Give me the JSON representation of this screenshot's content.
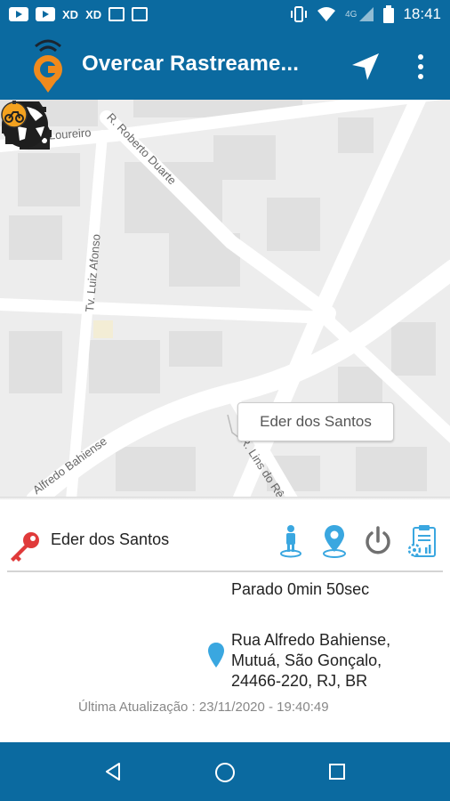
{
  "status_bar": {
    "clock": "18:41",
    "network": "4G",
    "left_labels": [
      "XD",
      "XD"
    ],
    "icons": [
      "youtube-icon",
      "youtube-icon",
      "xd-icon",
      "xd-icon",
      "image-icon",
      "calendar-icon",
      "vibrate-icon",
      "wifi-icon",
      "signal-icon",
      "battery-icon"
    ]
  },
  "app_bar": {
    "title": "Overcar Rastreame...",
    "icons": [
      "logo-icon",
      "navigation-arrow-icon",
      "more-vertical-icon"
    ]
  },
  "map": {
    "streets": [
      "R. Gen. Loureiro",
      "R. Roberto Duarte",
      "Tv. Luiz Afonso",
      "Alfredo Bahiense",
      "R. Lins do Rêc"
    ],
    "marker_label": "Eder dos Santos",
    "icons": [
      "traffic-icon",
      "globe-icon",
      "motorcycle-marker-icon"
    ]
  },
  "vehicle_panel": {
    "name": "Eder dos Santos",
    "status": "Parado 0min 50sec",
    "address_lines": [
      "Rua Alfredo Bahiense,",
      "Mutuá, São Gonçalo,",
      "24466-220, RJ, BR"
    ],
    "last_update": "Última Atualização : 23/11/2020 - 19:40:49",
    "icons": [
      "key-icon",
      "person-location-icon",
      "map-pin-icon",
      "power-icon",
      "report-settings-icon",
      "location-pin-icon"
    ]
  },
  "nav_bar": {
    "icons": [
      "back-icon",
      "home-icon",
      "recents-icon"
    ]
  },
  "colors": {
    "primary": "#0b6aa0",
    "accent_orange": "#f08a1c",
    "icon_blue": "#3aa7e0",
    "key_red": "#e03a3a",
    "map_background": "#ededed"
  }
}
